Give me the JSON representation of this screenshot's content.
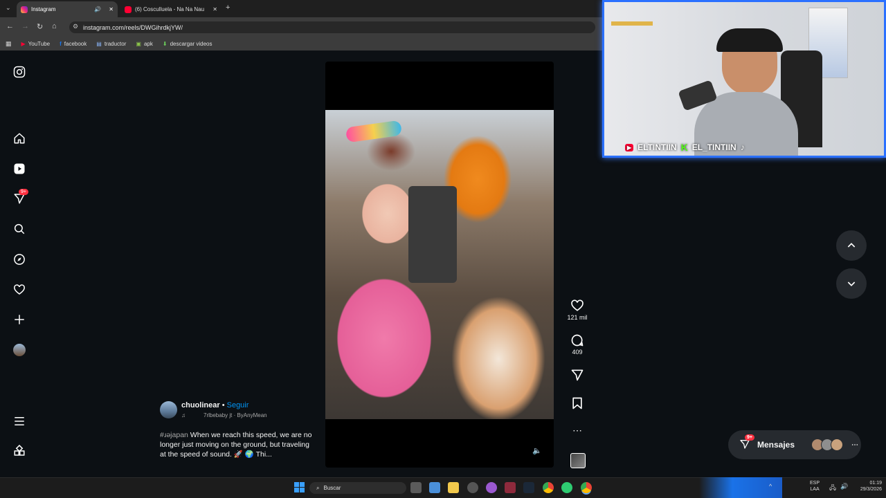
{
  "browser": {
    "tabs": [
      {
        "title": "Instagram",
        "active": true
      },
      {
        "title": "(6) Cosculluela - Na Na Nau (V",
        "active": false
      }
    ],
    "url": "instagram.com/reels/DWGihrdkjYW/",
    "bookmarks": [
      "YouTube",
      "facebook",
      "traductor",
      "apk",
      "descargar videos"
    ]
  },
  "sidebar": {
    "notification_badge": "9+"
  },
  "reel": {
    "username": "chuolinear",
    "follow": "Seguir",
    "audio": "7rlbebaby jt · ByAnyMean",
    "hashtag": "#ɹəjapan",
    "caption": "When we reach this speed, we are no longer just moving on the ground, but traveling at the speed of sound. 🚀 🌍 Thi...",
    "likes": "121 mil",
    "comments": "409"
  },
  "messages": {
    "label": "Mensajes",
    "badge": "9+"
  },
  "webcam": {
    "overlay_text": [
      "ELTINTIIN",
      "EL_TINTIIN"
    ]
  },
  "taskbar": {
    "search_label": "Buscar",
    "lang": "ESP",
    "lang2": "LAA",
    "time": "01:19",
    "date": "29/3/2026"
  },
  "colors": {
    "accent_blue": "#0095f6",
    "badge_red": "#ff3040",
    "cam_border": "#2a70ff"
  }
}
